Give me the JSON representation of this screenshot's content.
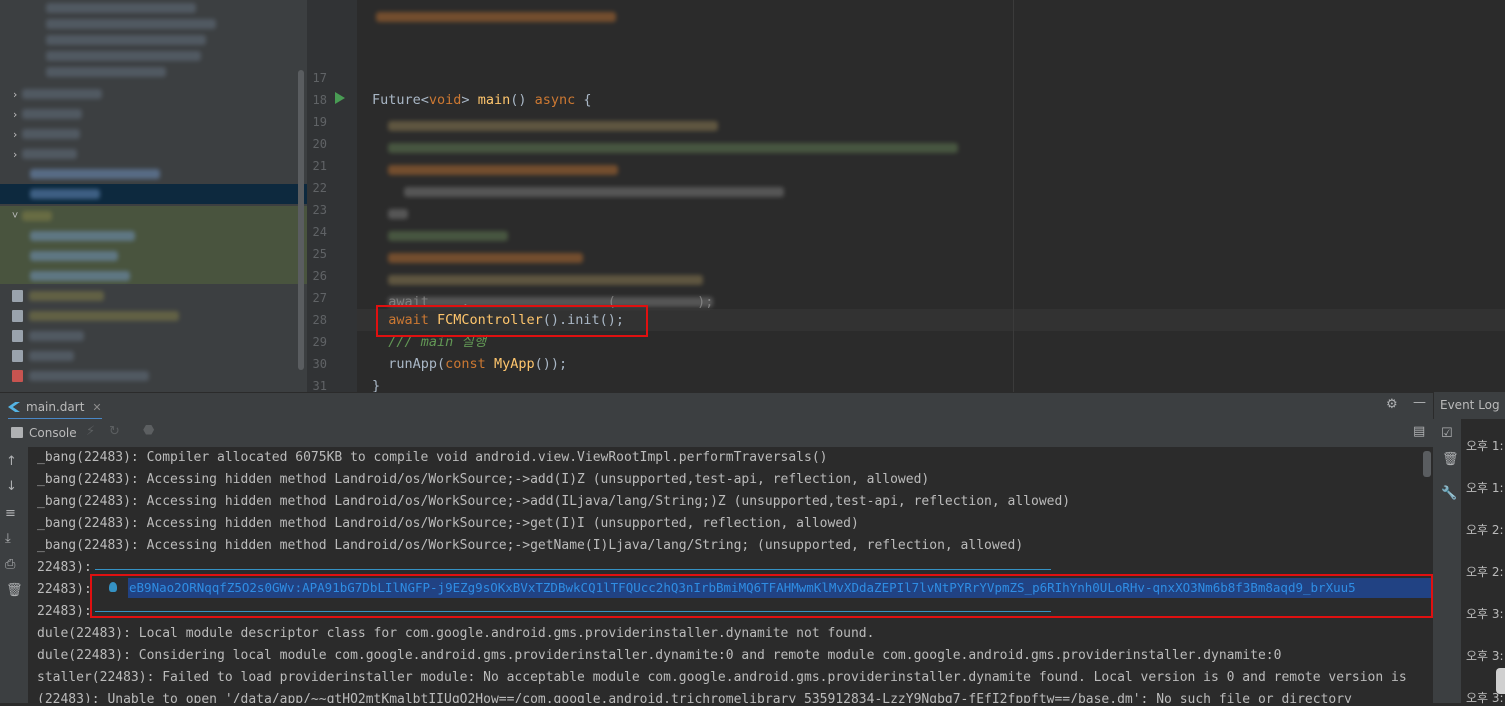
{
  "editor": {
    "lines": [
      {
        "num": "17",
        "text": ""
      },
      {
        "num": "18",
        "parts": [
          {
            "t": "Future<",
            "c": ""
          },
          {
            "t": "void",
            "c": "kw"
          },
          {
            "t": "> ",
            "c": ""
          },
          {
            "t": "main",
            "c": "fn"
          },
          {
            "t": "() ",
            "c": ""
          },
          {
            "t": "async",
            "c": "kw"
          },
          {
            "t": " {",
            "c": ""
          }
        ]
      },
      {
        "num": "19"
      },
      {
        "num": "20"
      },
      {
        "num": "21"
      },
      {
        "num": "22"
      },
      {
        "num": "23"
      },
      {
        "num": "24"
      },
      {
        "num": "25"
      },
      {
        "num": "26"
      },
      {
        "num": "27"
      },
      {
        "num": "28",
        "parts": [
          {
            "t": "  ",
            "c": ""
          },
          {
            "t": "await",
            "c": "kw"
          },
          {
            "t": " ",
            "c": ""
          },
          {
            "t": "FCMController",
            "c": "fn"
          },
          {
            "t": "().init();",
            "c": ""
          }
        ]
      },
      {
        "num": "29",
        "parts": [
          {
            "t": "  /// main 실행",
            "c": "cm"
          }
        ]
      },
      {
        "num": "30",
        "parts": [
          {
            "t": "  runApp(",
            "c": ""
          },
          {
            "t": "const",
            "c": "kw"
          },
          {
            "t": " ",
            "c": ""
          },
          {
            "t": "MyApp",
            "c": "fn"
          },
          {
            "t": "());",
            "c": ""
          }
        ]
      },
      {
        "num": "31",
        "parts": [
          {
            "t": "}",
            "c": ""
          }
        ]
      }
    ],
    "partial_line_27": "  await    .                 (          );"
  },
  "tool_window": {
    "tab_label": "main.dart",
    "console_label": "Console",
    "console_lines": [
      "_bang(22483): Compiler allocated 6075KB to compile void android.view.ViewRootImpl.performTraversals()",
      "_bang(22483): Accessing hidden method Landroid/os/WorkSource;->add(I)Z (unsupported,test-api, reflection, allowed)",
      "_bang(22483): Accessing hidden method Landroid/os/WorkSource;->add(ILjava/lang/String;)Z (unsupported,test-api, reflection, allowed)",
      "_bang(22483): Accessing hidden method Landroid/os/WorkSource;->get(I)I (unsupported, reflection, allowed)",
      "_bang(22483): Accessing hidden method Landroid/os/WorkSource;->getName(I)Ljava/lang/String; (unsupported, reflection, allowed)",
      "22483):",
      "22483):",
      "22483):",
      "dule(22483): Local module descriptor class for com.google.android.gms.providerinstaller.dynamite not found.",
      "dule(22483): Considering local module com.google.android.gms.providerinstaller.dynamite:0 and remote module com.google.android.gms.providerinstaller.dynamite:0",
      "staller(22483): Failed to load providerinstaller module: No acceptable module com.google.android.gms.providerinstaller.dynamite found. Local version is 0 and remote version is",
      "(22483): Unable to open '/data/app/~~qtHO2mtKmalbtIIUqO2How==/com.google.android.trichromelibrary_535912834-LzzY9Ngbg7-fEfI2fppftw==/base.dm': No such file or directory"
    ],
    "token": "eB9Nao2ORNqqfZ5O2s0GWv:APA91bG7DbLIlNGFP-j9EZg9sOKxBVxTZDBwkCQ1lTFQUcc2hQ3nIrbBmiMQ6TFAHMwmKlMvXDdaZEPIl7lvNtPYRrYVpmZS_p6RIhYnh0ULoRHv-qnxXO3Nm6b8f3Bm8aqd9_brXuu5"
  },
  "event_log": {
    "title": "Event Log",
    "entries": [
      "오후 1:",
      "오후 1:",
      "오후 2:",
      "오후 2:",
      "오후 3:",
      "오후 3:",
      "오후 3:"
    ]
  },
  "colors": {
    "highlight_box": "#e01010",
    "selection": "#214283",
    "link": "#2f8de4"
  }
}
